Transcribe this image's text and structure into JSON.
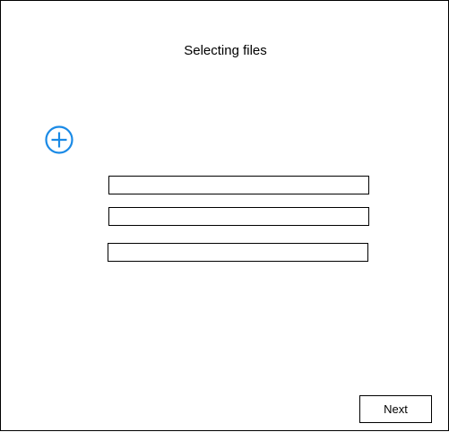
{
  "window": {
    "title": "Selecting files"
  },
  "add_button": {
    "icon": "plus-circle-icon",
    "color": "#1a8ae6"
  },
  "file_fields": [
    {
      "value": "",
      "placeholder": ""
    },
    {
      "value": "",
      "placeholder": ""
    },
    {
      "value": "",
      "placeholder": ""
    }
  ],
  "footer": {
    "next_label": "Next"
  }
}
